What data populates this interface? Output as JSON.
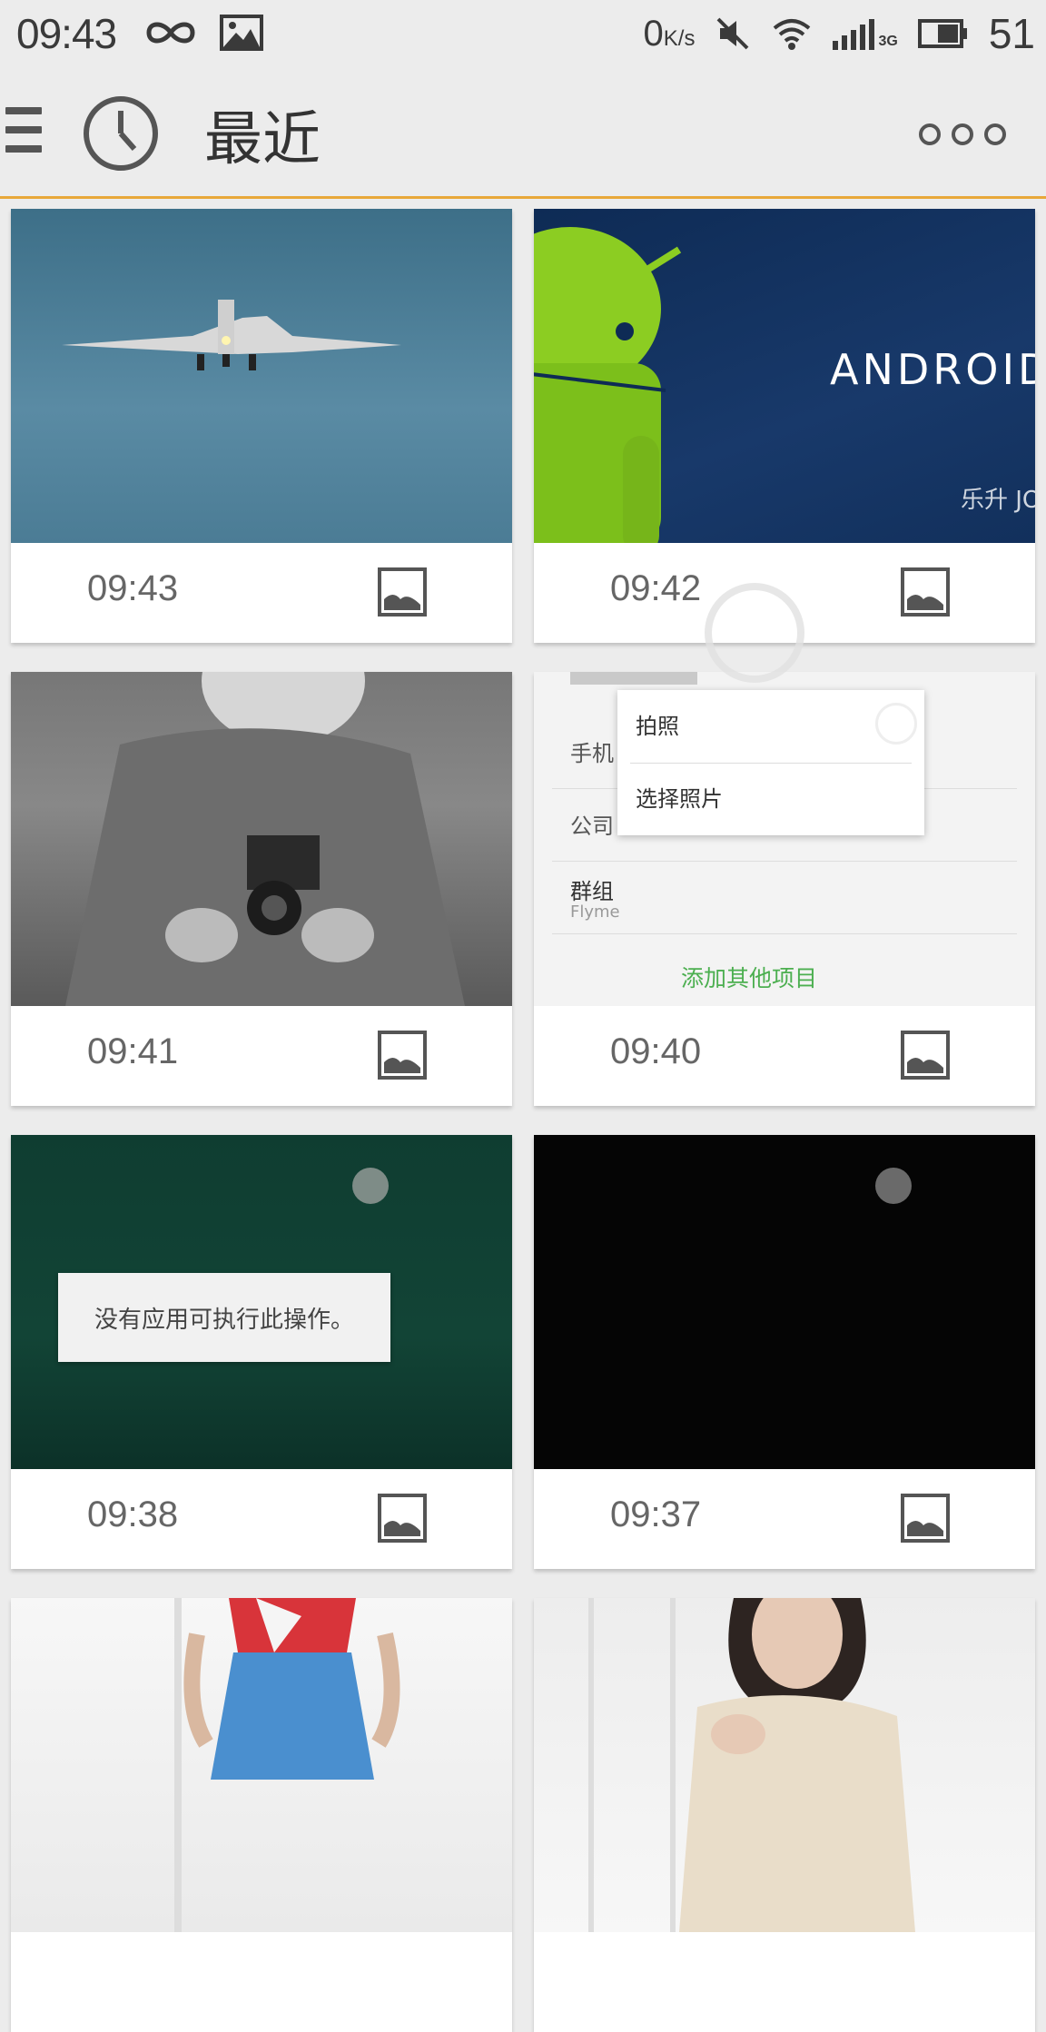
{
  "status_bar": {
    "time": "09:43",
    "net_speed": "0",
    "net_speed_unit": "K/s",
    "signal_type": "3G",
    "battery": "51"
  },
  "app_bar": {
    "title": "最近"
  },
  "items": [
    {
      "time": "09:43",
      "type_icon": "image-icon"
    },
    {
      "time": "09:42",
      "type_icon": "image-icon",
      "overlay_text": "ANDROID",
      "overlay_sub": "乐升 JOYUP"
    },
    {
      "time": "09:41",
      "type_icon": "image-icon"
    },
    {
      "time": "09:40",
      "type_icon": "image-icon",
      "popup_items": [
        "拍照",
        "选择照片"
      ],
      "form_labels": [
        "手机",
        "公司",
        "群组",
        "Flyme"
      ],
      "add_more": "添加其他项目"
    },
    {
      "time": "09:38",
      "type_icon": "image-icon",
      "toast": "没有应用可执行此操作。"
    },
    {
      "time": "09:37",
      "type_icon": "image-icon"
    },
    {
      "time": "",
      "type_icon": "image-icon"
    },
    {
      "time": "",
      "type_icon": "image-icon"
    }
  ],
  "colors": {
    "accent": "#e8a83a",
    "background": "#ececec",
    "card": "#ffffff"
  }
}
